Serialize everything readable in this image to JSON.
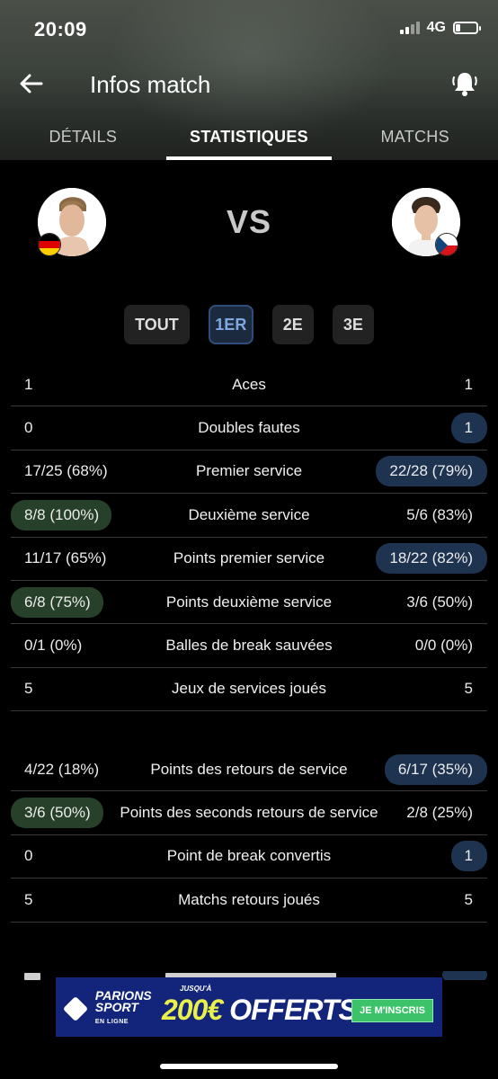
{
  "status_bar": {
    "time": "20:09",
    "network": "4G"
  },
  "header": {
    "title": "Infos match"
  },
  "tabs": [
    {
      "label": "DÉTAILS",
      "active": false
    },
    {
      "label": "STATISTIQUES",
      "active": true
    },
    {
      "label": "MATCHS",
      "active": false
    }
  ],
  "match": {
    "vs_text": "VS",
    "player_left_flag": "germany-flag",
    "player_right_flag": "czech-flag"
  },
  "sets": [
    {
      "label": "TOUT",
      "active": false
    },
    {
      "label": "1ER",
      "active": true
    },
    {
      "label": "2E",
      "active": false
    },
    {
      "label": "3E",
      "active": false
    }
  ],
  "service_stats": [
    {
      "label": "Aces",
      "left": "1",
      "right": "1",
      "winner": "none"
    },
    {
      "label": "Doubles fautes",
      "left": "0",
      "right": "1",
      "winner": "right"
    },
    {
      "label": "Premier service",
      "left": "17/25 (68%)",
      "right": "22/28 (79%)",
      "winner": "right"
    },
    {
      "label": "Deuxième service",
      "left": "8/8 (100%)",
      "right": "5/6 (83%)",
      "winner": "left"
    },
    {
      "label": "Points premier service",
      "left": "11/17 (65%)",
      "right": "18/22 (82%)",
      "winner": "right"
    },
    {
      "label": "Points deuxième service",
      "left": "6/8 (75%)",
      "right": "3/6 (50%)",
      "winner": "left"
    },
    {
      "label": "Balles de break sauvées",
      "left": "0/1 (0%)",
      "right": "0/0 (0%)",
      "winner": "none"
    },
    {
      "label": "Jeux de services joués",
      "left": "5",
      "right": "5",
      "winner": "none"
    }
  ],
  "return_stats": [
    {
      "label": "Points des retours de service",
      "left": "4/22 (18%)",
      "right": "6/17 (35%)",
      "winner": "right"
    },
    {
      "label": "Points des seconds retours de service",
      "left": "3/6 (50%)",
      "right": "2/8 (25%)",
      "winner": "left"
    },
    {
      "label": "Point de break convertis",
      "left": "0",
      "right": "1",
      "winner": "right"
    },
    {
      "label": "Matchs retours joués",
      "left": "5",
      "right": "5",
      "winner": "none"
    }
  ],
  "ad": {
    "brand_line1": "PARIONS",
    "brand_line2": "SPORT",
    "brand_sub": "EN LIGNE",
    "small_text": "JUSQU'À",
    "offer_amount": "200€",
    "offer_text": "OFFERTS",
    "cta": "JE M'INSCRIS"
  },
  "colors": {
    "left_win_bg": "#27402a",
    "right_win_bg": "#1e3350",
    "active_set": "#7fa8df"
  }
}
